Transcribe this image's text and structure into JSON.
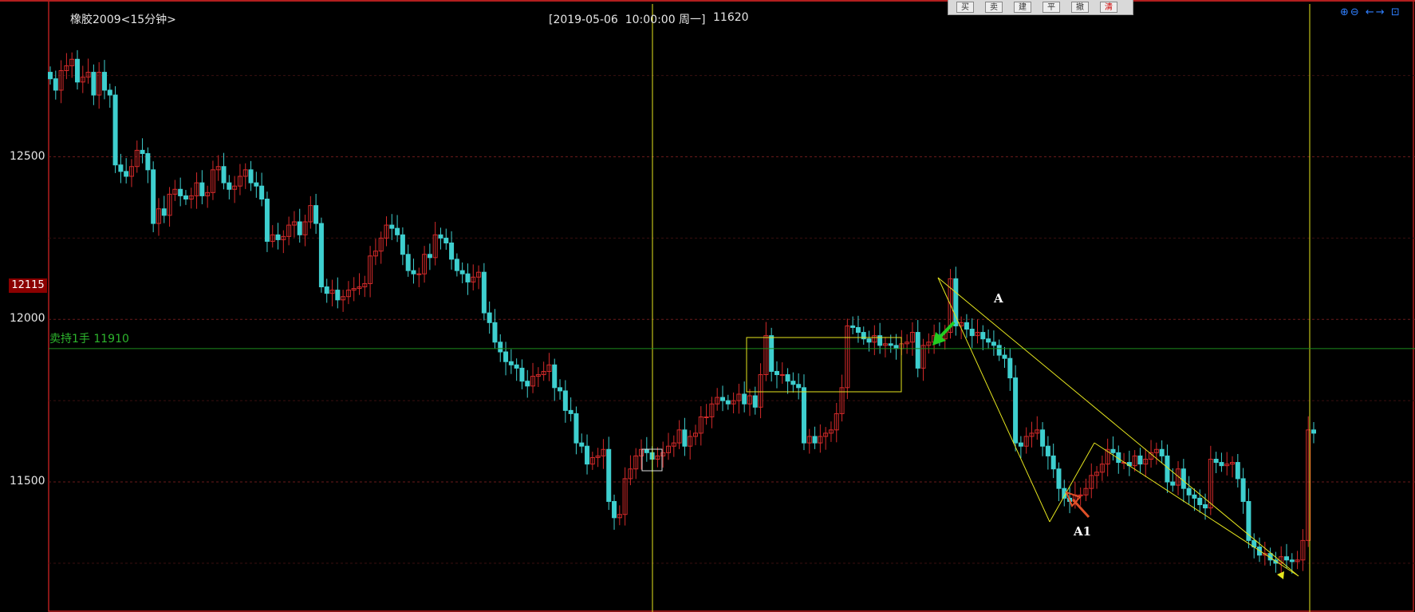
{
  "header": {
    "symbol": "橡胶2009<15分钟>",
    "cursor_time": "[2019-05-06  10:00:00 周一]",
    "cursor_value": "11620"
  },
  "toolbar": {
    "buttons": [
      "买",
      "卖",
      "建",
      "平",
      "撤",
      "清"
    ]
  },
  "corner_icons": "⊕⊖ ←→ ⊡",
  "price_tag": "12115",
  "order_line": {
    "label": "卖持1手 11910",
    "color": "#1e8c1e"
  },
  "annotations": {
    "a": "A",
    "a1": "A1"
  },
  "colors": {
    "up": "#d42a2a",
    "down": "#3ecfcf",
    "drawing": "#e6e61e",
    "crosshair": "#e6e61e",
    "border": "#b21e1e"
  },
  "chart_data": {
    "type": "candlestick",
    "title": "橡胶2009<15分钟>",
    "yticks": [
      12500,
      12000,
      11500
    ],
    "ylim": [
      11100,
      12970
    ],
    "xlabel": "",
    "ylabel": "",
    "grid": true,
    "series": [
      {
        "values": [
          12740,
          12705,
          12765,
          12780,
          12800,
          12730,
          12745,
          12760,
          12690,
          12760,
          12705,
          12690,
          12475,
          12455,
          12440,
          12470,
          12520,
          12510,
          12460,
          12295,
          12340,
          12320,
          12385,
          12400,
          12380,
          12370,
          12380,
          12420,
          12380,
          12390,
          12460,
          12470,
          12420,
          12400,
          12410,
          12440,
          12460,
          12420,
          12410,
          12370,
          12240,
          12260,
          12245,
          12255,
          12290,
          12300,
          12260,
          12300,
          12350,
          12295,
          12100,
          12080,
          12090,
          12060,
          12070,
          12090,
          12095,
          12100,
          12110,
          12195,
          12210,
          12250,
          12290,
          12280,
          12260,
          12200,
          12150,
          12140,
          12140,
          12200,
          12190,
          12260,
          12250,
          12235,
          12185,
          12150,
          12140,
          12115,
          12130,
          12145,
          12020,
          11990,
          11930,
          11900,
          11870,
          11860,
          11850,
          11810,
          11795,
          11825,
          11830,
          11840,
          11860,
          11790,
          11780,
          11720,
          11710,
          11620,
          11610,
          11555,
          11575,
          11580,
          11600,
          11440,
          11390,
          11400,
          11510,
          11540,
          11580,
          11600,
          11590,
          11570,
          11580,
          11590,
          11610,
          11620,
          11660,
          11610,
          11640,
          11650,
          11700,
          11700,
          11740,
          11760,
          11750,
          11740,
          11750,
          11770,
          11740,
          11765,
          11730,
          11830,
          11950,
          11840,
          11830,
          11830,
          11810,
          11800,
          11790,
          11620,
          11640,
          11620,
          11640,
          11650,
          11660,
          11710,
          11790,
          11980,
          11975,
          11960,
          11940,
          11930,
          11950,
          11920,
          11925,
          11920,
          11910,
          11925,
          11930,
          11960,
          11850,
          11920,
          11930,
          11950,
          11940,
          11960,
          12125,
          11980,
          11990,
          11970,
          11950,
          11960,
          11940,
          11930,
          11920,
          11890,
          11880,
          11820,
          11620,
          11610,
          11640,
          11650,
          11660,
          11610,
          11580,
          11540,
          11480,
          11450,
          11440,
          11460,
          11460,
          11480,
          11520,
          11530,
          11555,
          11600,
          11590,
          11560,
          11560,
          11550,
          11580,
          11555,
          11570,
          11590,
          11600,
          11580,
          11500,
          11490,
          11540,
          11480,
          11460,
          11450,
          11430,
          11420,
          11570,
          11560,
          11550,
          11555,
          11560,
          11510,
          11440,
          11320,
          11300,
          11275,
          11280,
          11260,
          11250,
          11270,
          11260,
          11255,
          11260,
          11320,
          11660,
          11650
        ]
      }
    ]
  }
}
